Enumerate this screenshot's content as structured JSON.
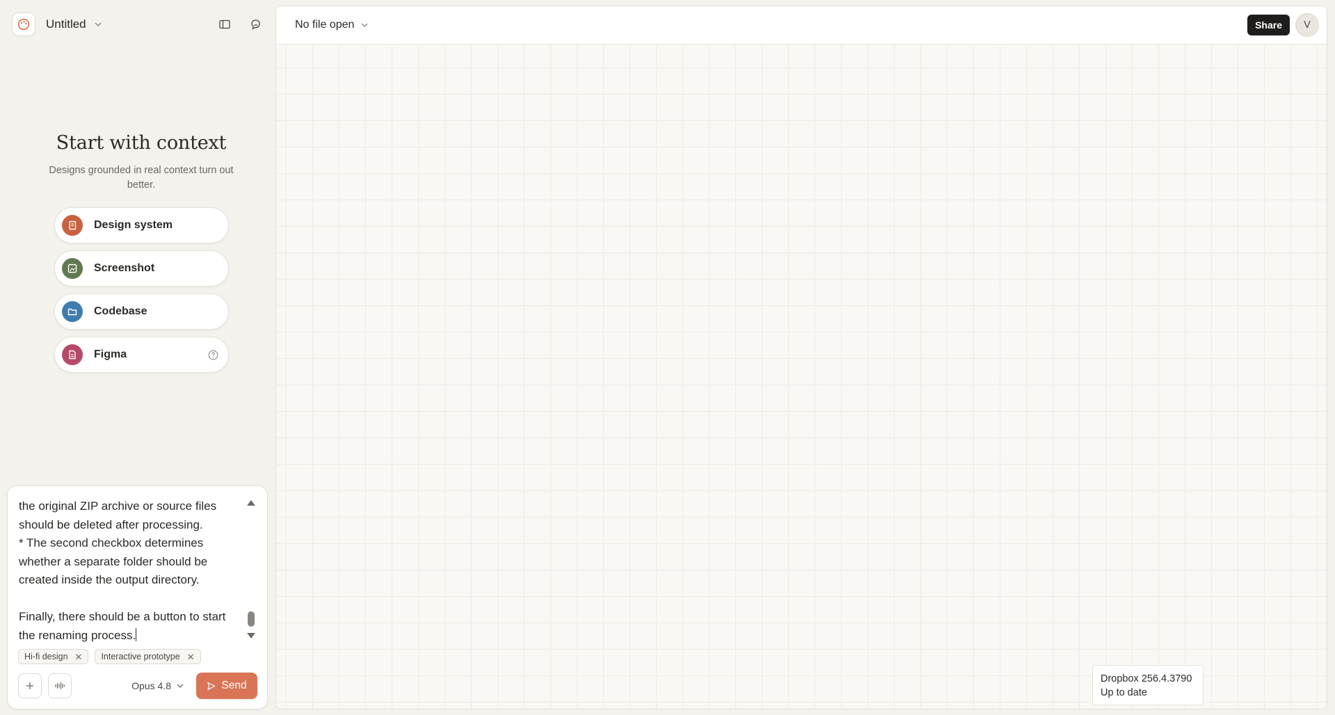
{
  "app": {
    "project_title": "Untitled",
    "icons": {
      "logo": "palette-icon",
      "sidebar_toggle": "sidebar-panel-icon",
      "notifications": "chat-bell-icon"
    }
  },
  "context": {
    "title": "Start with context",
    "subtitle": "Designs grounded in real context turn out better.",
    "items": [
      {
        "label": "Design system",
        "icon": "book-icon",
        "color": "#c8613f"
      },
      {
        "label": "Screenshot",
        "icon": "image-icon",
        "color": "#5f7a4f"
      },
      {
        "label": "Codebase",
        "icon": "folder-icon",
        "color": "#3f7cb0"
      },
      {
        "label": "Figma",
        "icon": "document-icon",
        "color": "#b54a68",
        "has_help": true
      }
    ]
  },
  "composer": {
    "text_lines": [
      "the original ZIP archive or source files",
      "should be deleted after processing.",
      "* The second checkbox determines",
      "whether a separate folder should be",
      "created inside the output directory.",
      "",
      "Finally, there should be a button to start",
      "the renaming process."
    ],
    "chips": [
      "Hi-fi design",
      "Interactive prototype"
    ],
    "model": "Opus 4.8",
    "send_label": "Send",
    "accent": "#d97556"
  },
  "canvas": {
    "file_selector": "No file open",
    "share_label": "Share",
    "avatar_initial": "V"
  },
  "toast": {
    "line1": "Dropbox 256.4.3790",
    "line2": "Up to date"
  }
}
